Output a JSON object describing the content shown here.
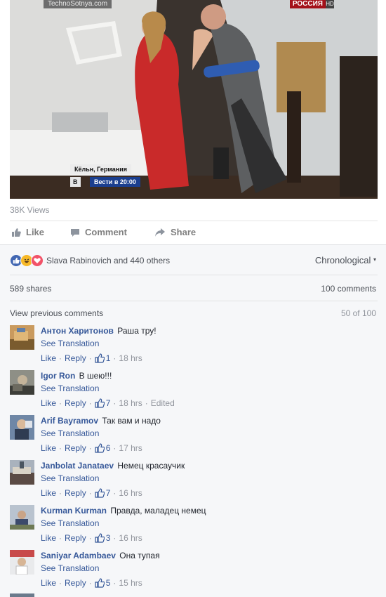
{
  "video": {
    "watermark_left": "TechnoSotnya.com",
    "watermark_right": "РОССИЯ",
    "watermark_hd": "HD",
    "caption_location": "Кёльн, Германия",
    "caption_logo": "В",
    "caption_show": "Вести в 20:00",
    "mic_label": "РОССИЯ"
  },
  "post": {
    "views": "38K Views",
    "like_label": "Like",
    "comment_label": "Comment",
    "share_label": "Share"
  },
  "reactions": {
    "summary": "Slava Rabinovich and 440 others",
    "sort_label": "Chronological",
    "icons": [
      "like-icon",
      "haha-icon",
      "love-icon"
    ],
    "colors": {
      "like": "#4267b2",
      "haha": "#f7b928",
      "love": "#f25268"
    }
  },
  "stats": {
    "shares": "589 shares",
    "comments": "100 comments"
  },
  "comments_header": {
    "view_previous": "View previous comments",
    "page_count": "50 of 100"
  },
  "comments": [
    {
      "author": "Антон Харитонов",
      "text": "Раша тру!",
      "translate": "See Translation",
      "like": "Like",
      "reply": "Reply",
      "likes": "1",
      "time": "18 hrs",
      "edited": ""
    },
    {
      "author": "Igor Ron",
      "text": "В шею!!!",
      "translate": "See Translation",
      "like": "Like",
      "reply": "Reply",
      "likes": "7",
      "time": "18 hrs",
      "edited": "Edited"
    },
    {
      "author": "Arif Bayramov",
      "text": "Так вам и надо",
      "translate": "See Translation",
      "like": "Like",
      "reply": "Reply",
      "likes": "6",
      "time": "17 hrs",
      "edited": ""
    },
    {
      "author": "Janbolat Janataev",
      "text": "Немец красаучик",
      "translate": "See Translation",
      "like": "Like",
      "reply": "Reply",
      "likes": "7",
      "time": "16 hrs",
      "edited": ""
    },
    {
      "author": "Kurman Kurman",
      "text": "Правда, маладец немец",
      "translate": "See Translation",
      "like": "Like",
      "reply": "Reply",
      "likes": "3",
      "time": "16 hrs",
      "edited": ""
    },
    {
      "author": "Saniyar Adambaev",
      "text": "Она тупая",
      "translate": "See Translation",
      "like": "Like",
      "reply": "Reply",
      "likes": "5",
      "time": "15 hrs",
      "edited": ""
    }
  ]
}
